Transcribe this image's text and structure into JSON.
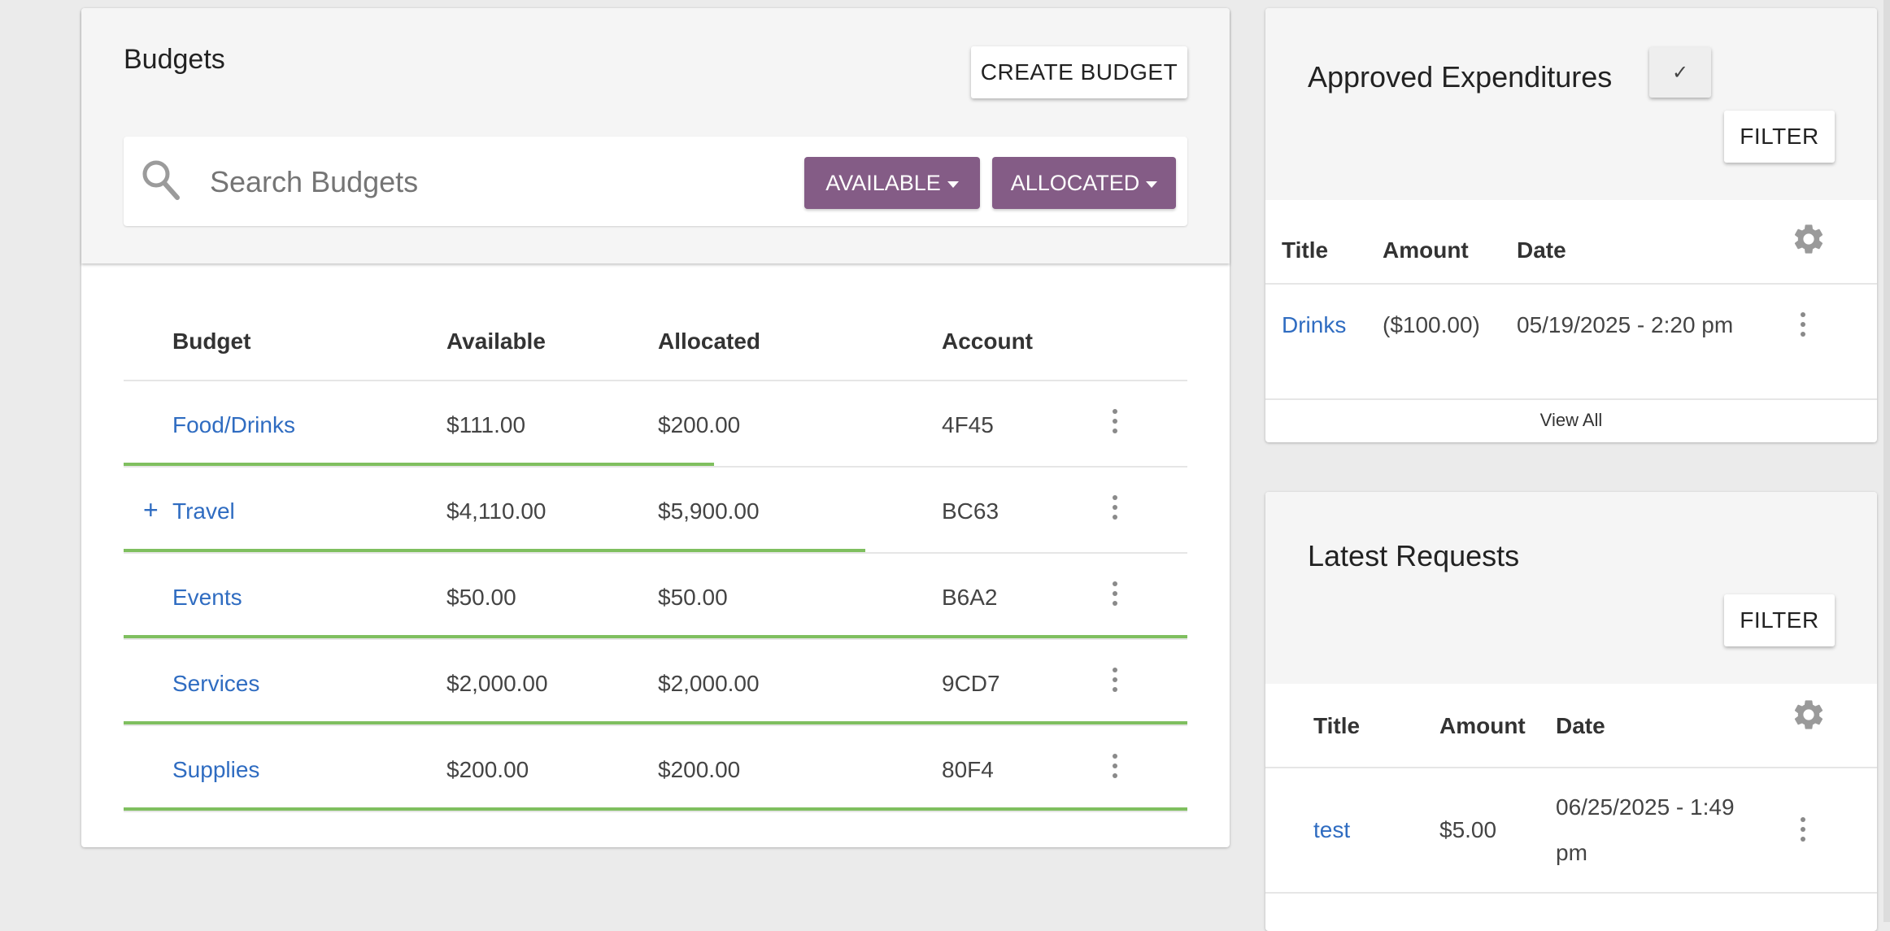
{
  "budgets": {
    "title": "Budgets",
    "create_label": "CREATE BUDGET",
    "search_placeholder": "Search Budgets",
    "available_filter": "AVAILABLE",
    "allocated_filter": "ALLOCATED",
    "columns": [
      "Budget",
      "Available",
      "Allocated",
      "Account"
    ],
    "rows": [
      {
        "expand": "",
        "name": "Food/Drinks",
        "available": "$111.00",
        "allocated": "$200.00",
        "account": "4F45",
        "progress": 0.555
      },
      {
        "expand": "+",
        "name": "Travel",
        "available": "$4,110.00",
        "allocated": "$5,900.00",
        "account": "BC63",
        "progress": 0.697
      },
      {
        "expand": "",
        "name": "Events",
        "available": "$50.00",
        "allocated": "$50.00",
        "account": "B6A2",
        "progress": 1.0
      },
      {
        "expand": "",
        "name": "Services",
        "available": "$2,000.00",
        "allocated": "$2,000.00",
        "account": "9CD7",
        "progress": 1.0
      },
      {
        "expand": "",
        "name": "Supplies",
        "available": "$200.00",
        "allocated": "$200.00",
        "account": "80F4",
        "progress": 1.0
      }
    ]
  },
  "approved": {
    "title": "Approved Expenditures",
    "check_symbol": "✓",
    "filter_label": "FILTER",
    "columns": [
      "Title",
      "Amount",
      "Date"
    ],
    "rows": [
      {
        "title": "Drinks",
        "amount": "($100.00)",
        "date": "05/19/2025 - 2:20 pm"
      }
    ],
    "view_all": "View All"
  },
  "latest": {
    "title": "Latest Requests",
    "filter_label": "FILTER",
    "columns": [
      "Title",
      "Amount",
      "Date"
    ],
    "rows": [
      {
        "title": "test",
        "amount": "$5.00",
        "date_line1": "06/25/2025 - 1:49",
        "date_line2": "pm"
      }
    ]
  },
  "colors": {
    "accent_purple": "#845c86",
    "link_blue": "#2f6cc1",
    "progress_green": "#7fbf5f"
  },
  "icons": {
    "search": "search-icon",
    "settings": "gear-icon",
    "row_menu": "more-vertical-icon",
    "check": "check-icon"
  }
}
